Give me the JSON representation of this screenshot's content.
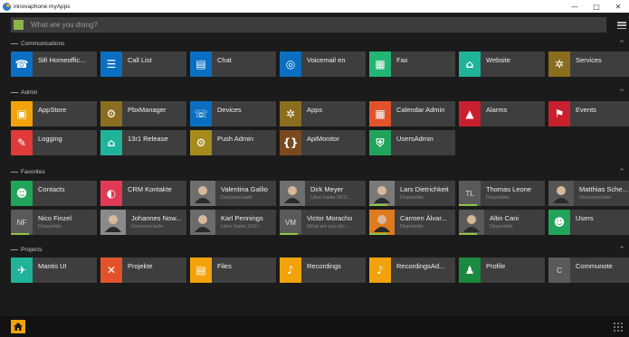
{
  "window": {
    "title": "innovaphone myApps",
    "minimize": "—",
    "restore": "□",
    "close": "✕"
  },
  "search": {
    "placeholder": "What are you doing?"
  },
  "sections": {
    "communications": {
      "title": "Communications"
    },
    "admin": {
      "title": "Admin"
    },
    "favorites": {
      "title": "Favorites"
    },
    "projects": {
      "title": "Projects"
    }
  },
  "communications": [
    {
      "name": "Sifi Homeoffic...",
      "icon": "phone-icon",
      "color": "#0a6fc2"
    },
    {
      "name": "Call List",
      "icon": "call-list-icon",
      "color": "#0a6fc2"
    },
    {
      "name": "Chat",
      "icon": "chat-icon",
      "color": "#0a6fc2"
    },
    {
      "name": "Voicemail en",
      "icon": "voicemail-icon",
      "color": "#0a6fc2"
    },
    {
      "name": "Fax",
      "icon": "fax-icon",
      "color": "#22b573"
    },
    {
      "name": "Website",
      "icon": "website-icon",
      "color": "#1fb39a"
    },
    {
      "name": "Services",
      "icon": "services-icon",
      "color": "#8a6d1e"
    }
  ],
  "admin": [
    {
      "name": "AppStore",
      "icon": "appstore-icon",
      "color": "#f2a20a"
    },
    {
      "name": "PbxManager",
      "icon": "pbx-manager-icon",
      "color": "#8a6d1e"
    },
    {
      "name": "Devices",
      "icon": "devices-icon",
      "color": "#0a6fc2"
    },
    {
      "name": "Apps",
      "icon": "apps-icon",
      "color": "#8a6d1e"
    },
    {
      "name": "Calendar Admin",
      "icon": "calendar-icon",
      "color": "#e2532c"
    },
    {
      "name": "Alarms",
      "icon": "alarm-icon",
      "color": "#c8202f"
    },
    {
      "name": "Events",
      "icon": "events-icon",
      "color": "#c8202f"
    },
    {
      "name": "Logging",
      "icon": "logging-icon",
      "color": "#e03a3a"
    },
    {
      "name": "13r1 Release",
      "icon": "release-icon",
      "color": "#1fb39a"
    },
    {
      "name": "Push Admin",
      "icon": "push-admin-icon",
      "color": "#a68a1e"
    },
    {
      "name": "ApiMonitor",
      "icon": "api-monitor-icon",
      "color": "#7a4a1e"
    },
    {
      "name": "UsersAdmin",
      "icon": "users-admin-icon",
      "color": "#22a35a"
    }
  ],
  "favorites": [
    {
      "name": "Contacts",
      "status": "",
      "icon": "contacts-icon",
      "color": "#22a35a",
      "kind": "app"
    },
    {
      "name": "CRM Kontakte",
      "status": "",
      "icon": "crm-icon",
      "color": "#e03a55",
      "kind": "app"
    },
    {
      "name": "Valentina Gallio",
      "status": "Desconectado",
      "icon": "avatar",
      "color": "#6e6e6e",
      "kind": "photo"
    },
    {
      "name": "Dirk Meyer",
      "status": "Libre hasta 16/1/...",
      "icon": "avatar",
      "color": "#6e6e6e",
      "kind": "photo"
    },
    {
      "name": "Lars Dietrichkeit",
      "status": "Disponible",
      "icon": "avatar",
      "color": "#7a7a7a",
      "kind": "photo",
      "bar": true
    },
    {
      "name": "Thomas Leone",
      "status": "Disponible",
      "icon": "initials",
      "initials": "TL",
      "kind": "initials",
      "bar": true
    },
    {
      "name": "Matthias Sche...",
      "status": "Desconectado",
      "icon": "avatar",
      "color": "#555555",
      "kind": "photo"
    },
    {
      "name": "Nico Finzel",
      "status": "Disponible",
      "icon": "initials",
      "initials": "NF",
      "kind": "initials",
      "bar": true
    },
    {
      "name": "Johannes Now...",
      "status": "Desconectado",
      "icon": "avatar",
      "color": "#8a8a8a",
      "kind": "photo"
    },
    {
      "name": "Karl Pennings",
      "status": "Libre hasta 15/1/...",
      "icon": "avatar",
      "color": "#6b6b6b",
      "kind": "photo"
    },
    {
      "name": "Victor Moracho",
      "status": "What are you doi...",
      "icon": "initials",
      "initials": "VM",
      "kind": "initials",
      "bar": true
    },
    {
      "name": "Carmen Álvar...",
      "status": "Disponible",
      "icon": "avatar",
      "color": "#e07a1e",
      "kind": "photo",
      "bar": true
    },
    {
      "name": "Altin Cani",
      "status": "Disponible",
      "icon": "avatar",
      "color": "#5a5a5a",
      "kind": "photo",
      "bar": true
    },
    {
      "name": "Users",
      "status": "",
      "icon": "users-icon",
      "color": "#22a35a",
      "kind": "app"
    }
  ],
  "projects": [
    {
      "name": "Mantis UI",
      "icon": "mantis-icon",
      "color": "#1fb39a"
    },
    {
      "name": "Projekte",
      "icon": "projects-icon",
      "color": "#e2532c"
    },
    {
      "name": "Files",
      "icon": "files-icon",
      "color": "#f2a20a"
    },
    {
      "name": "Recordings",
      "icon": "recordings-icon",
      "color": "#f2a20a"
    },
    {
      "name": "RecordingsAd...",
      "icon": "recordings-admin-icon",
      "color": "#f2a20a"
    },
    {
      "name": "Profile",
      "icon": "profile-icon",
      "color": "#1a8a3e"
    },
    {
      "name": "Communote",
      "icon": "initials",
      "initials": "C",
      "color": "#5a5a5a"
    }
  ],
  "bottom": {
    "home_icon": "home-icon",
    "apps_icon": "grid-icon"
  }
}
